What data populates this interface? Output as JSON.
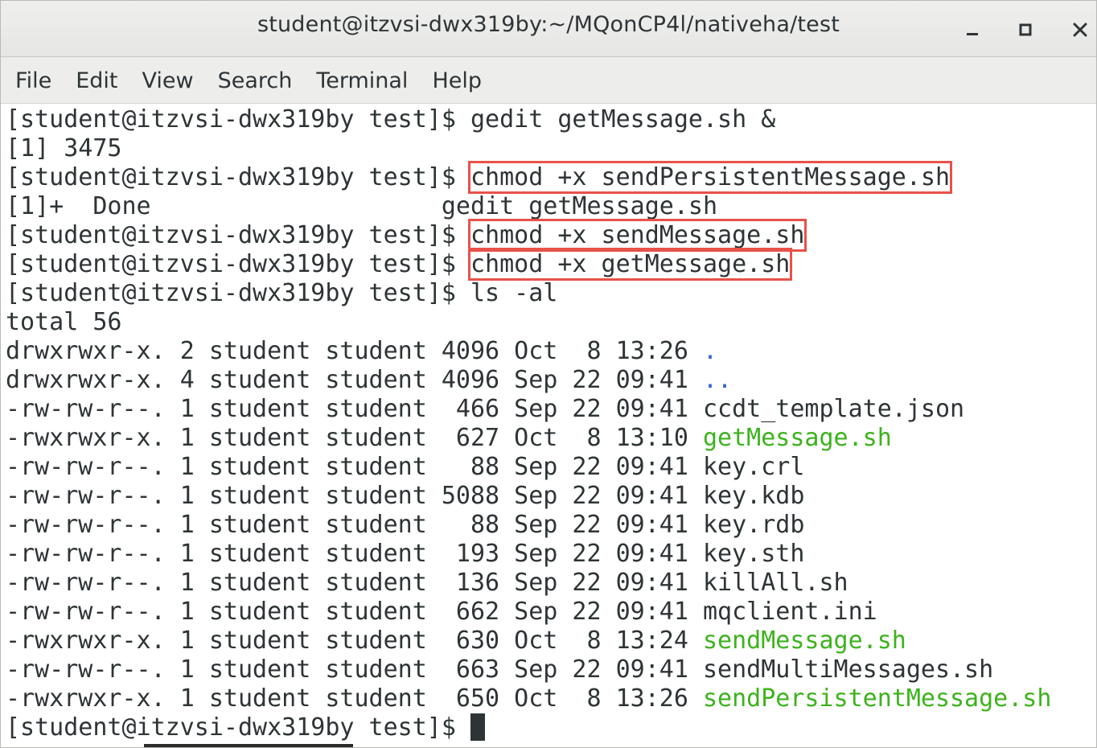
{
  "window": {
    "title": "student@itzvsi-dwx319by:~/MQonCP4l/nativeha/test",
    "minimize_icon": "minimize-icon",
    "maximize_icon": "maximize-icon",
    "close_icon": "close-icon"
  },
  "menu": [
    "File",
    "Edit",
    "View",
    "Search",
    "Terminal",
    "Help"
  ],
  "colors": {
    "highlight_box": "#e8524a",
    "dir_blue": "#3465d4",
    "exec_green": "#3cb31c"
  },
  "prompt": "[student@itzvsi-dwx319by test]$ ",
  "terminal": {
    "cmd1": "gedit getMessage.sh &",
    "job_start": "[1] 3475",
    "cmd2": "chmod +x sendPersistentMessage.sh",
    "job_done_prefix": "[1]+  Done                    ",
    "job_done_cmd": "gedit getMessage.sh",
    "cmd3": "chmod +x sendMessage.sh",
    "cmd4": "chmod +x getMessage.sh",
    "cmd5": "ls -al",
    "total": "total 56",
    "listing": [
      {
        "meta": "drwxrwxr-x. 2 student student 4096 Oct  8 13:26 ",
        "name": ".",
        "kind": "dir"
      },
      {
        "meta": "drwxrwxr-x. 4 student student 4096 Sep 22 09:41 ",
        "name": "..",
        "kind": "dir"
      },
      {
        "meta": "-rw-rw-r--. 1 student student  466 Sep 22 09:41 ",
        "name": "ccdt_template.json",
        "kind": "file"
      },
      {
        "meta": "-rwxrwxr-x. 1 student student  627 Oct  8 13:10 ",
        "name": "getMessage.sh",
        "kind": "exec"
      },
      {
        "meta": "-rw-rw-r--. 1 student student   88 Sep 22 09:41 ",
        "name": "key.crl",
        "kind": "file"
      },
      {
        "meta": "-rw-rw-r--. 1 student student 5088 Sep 22 09:41 ",
        "name": "key.kdb",
        "kind": "file"
      },
      {
        "meta": "-rw-rw-r--. 1 student student   88 Sep 22 09:41 ",
        "name": "key.rdb",
        "kind": "file"
      },
      {
        "meta": "-rw-rw-r--. 1 student student  193 Sep 22 09:41 ",
        "name": "key.sth",
        "kind": "file"
      },
      {
        "meta": "-rw-rw-r--. 1 student student  136 Sep 22 09:41 ",
        "name": "killAll.sh",
        "kind": "file"
      },
      {
        "meta": "-rw-rw-r--. 1 student student  662 Sep 22 09:41 ",
        "name": "mqclient.ini",
        "kind": "file"
      },
      {
        "meta": "-rwxrwxr-x. 1 student student  630 Oct  8 13:24 ",
        "name": "sendMessage.sh",
        "kind": "exec"
      },
      {
        "meta": "-rw-rw-r--. 1 student student  663 Sep 22 09:41 ",
        "name": "sendMultiMessages.sh",
        "kind": "file"
      },
      {
        "meta": "-rwxrwxr-x. 1 student student  650 Oct  8 13:26 ",
        "name": "sendPersistentMessage.sh",
        "kind": "exec"
      }
    ]
  }
}
